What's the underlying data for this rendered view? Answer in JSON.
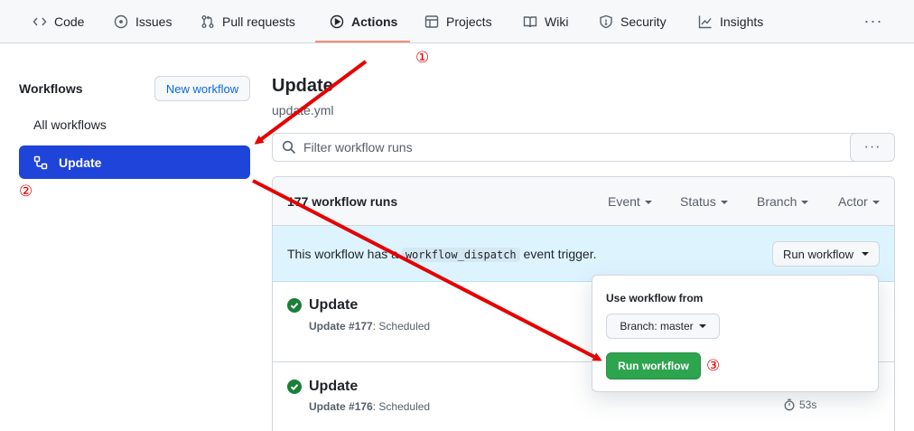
{
  "nav": {
    "tabs": [
      {
        "label": "Code",
        "icon": "code-icon"
      },
      {
        "label": "Issues",
        "icon": "issue-icon"
      },
      {
        "label": "Pull requests",
        "icon": "pull-request-icon"
      },
      {
        "label": "Actions",
        "icon": "play-icon"
      },
      {
        "label": "Projects",
        "icon": "table-icon"
      },
      {
        "label": "Wiki",
        "icon": "book-icon"
      },
      {
        "label": "Security",
        "icon": "shield-icon"
      },
      {
        "label": "Insights",
        "icon": "graph-icon"
      }
    ],
    "active_tab": "Actions",
    "more": "···"
  },
  "sidebar": {
    "title": "Workflows",
    "new_workflow": "New workflow",
    "items": [
      {
        "label": "All workflows"
      },
      {
        "label": "Update",
        "icon": "workflow-icon",
        "selected": true
      }
    ]
  },
  "main": {
    "title": "Update",
    "file": "update.yml",
    "filter_placeholder": "Filter workflow runs",
    "more": "···",
    "runs_count": "177 workflow runs",
    "filters": [
      "Event",
      "Status",
      "Branch",
      "Actor"
    ],
    "dispatch": {
      "text_before": "This workflow has a",
      "code": "workflow_dispatch",
      "text_after": "event trigger.",
      "button": "Run workflow"
    },
    "runs": [
      {
        "title": "Update",
        "name": "Update",
        "number": "#177",
        "trigger": ": Scheduled",
        "status": "success"
      },
      {
        "title": "Update",
        "name": "Update",
        "number": "#176",
        "trigger": ": Scheduled",
        "status": "success",
        "duration": "53s"
      }
    ]
  },
  "popover": {
    "title": "Use workflow from",
    "branch_button": "Branch: master",
    "run_button": "Run workflow"
  },
  "annotations": {
    "step1": "①",
    "step2": "②",
    "step3": "③",
    "color": "#e60000"
  }
}
